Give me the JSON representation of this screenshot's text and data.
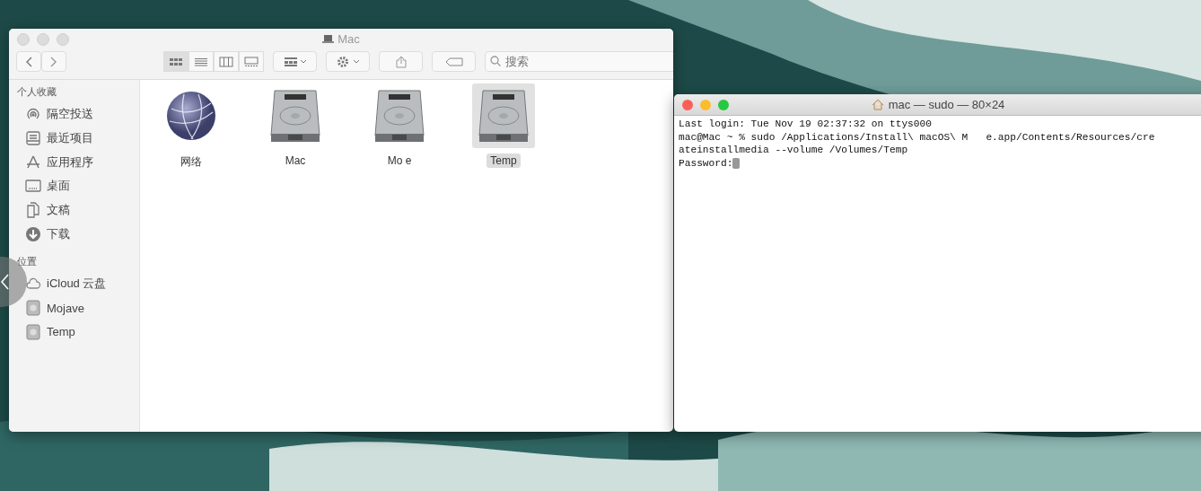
{
  "finder": {
    "title": "Mac",
    "toolbar": {
      "search": {
        "placeholder": "搜索"
      },
      "views": [
        {
          "kind": "icons",
          "selected": true
        },
        {
          "kind": "list",
          "selected": false
        },
        {
          "kind": "columns",
          "selected": false
        },
        {
          "kind": "gallery",
          "selected": false
        }
      ]
    },
    "sidebar": [
      {
        "heading": "个人收藏",
        "items": [
          {
            "label": "隔空投送",
            "kind": "airdrop"
          },
          {
            "label": "最近项目",
            "kind": "recents"
          },
          {
            "label": "应用程序",
            "kind": "apps"
          },
          {
            "label": "桌面",
            "kind": "desktop"
          },
          {
            "label": "文稿",
            "kind": "docs"
          },
          {
            "label": "下载",
            "kind": "download"
          }
        ]
      },
      {
        "heading": "位置",
        "items": [
          {
            "label": "iCloud 云盘",
            "kind": "cloud"
          },
          {
            "label": "Mojave",
            "kind": "disk"
          },
          {
            "label": "Temp",
            "kind": "disk"
          }
        ]
      }
    ],
    "items": [
      {
        "label": "网络",
        "kind": "globe",
        "selected": false
      },
      {
        "label": "Mac",
        "kind": "disk",
        "selected": false
      },
      {
        "label": "Mo e",
        "kind": "disk",
        "selected": false
      },
      {
        "label": "Temp",
        "kind": "disk",
        "selected": true
      }
    ]
  },
  "terminal": {
    "title": "mac — sudo — 80×24",
    "lines": [
      "Last login: Tue Nov 19 02:37:32 on ttys000",
      "mac@Mac ~ % sudo /Applications/Install\\ macOS\\ M   e.app/Contents/Resources/cre",
      "ateinstallmedia --volume /Volumes/Temp",
      "Password:"
    ]
  }
}
